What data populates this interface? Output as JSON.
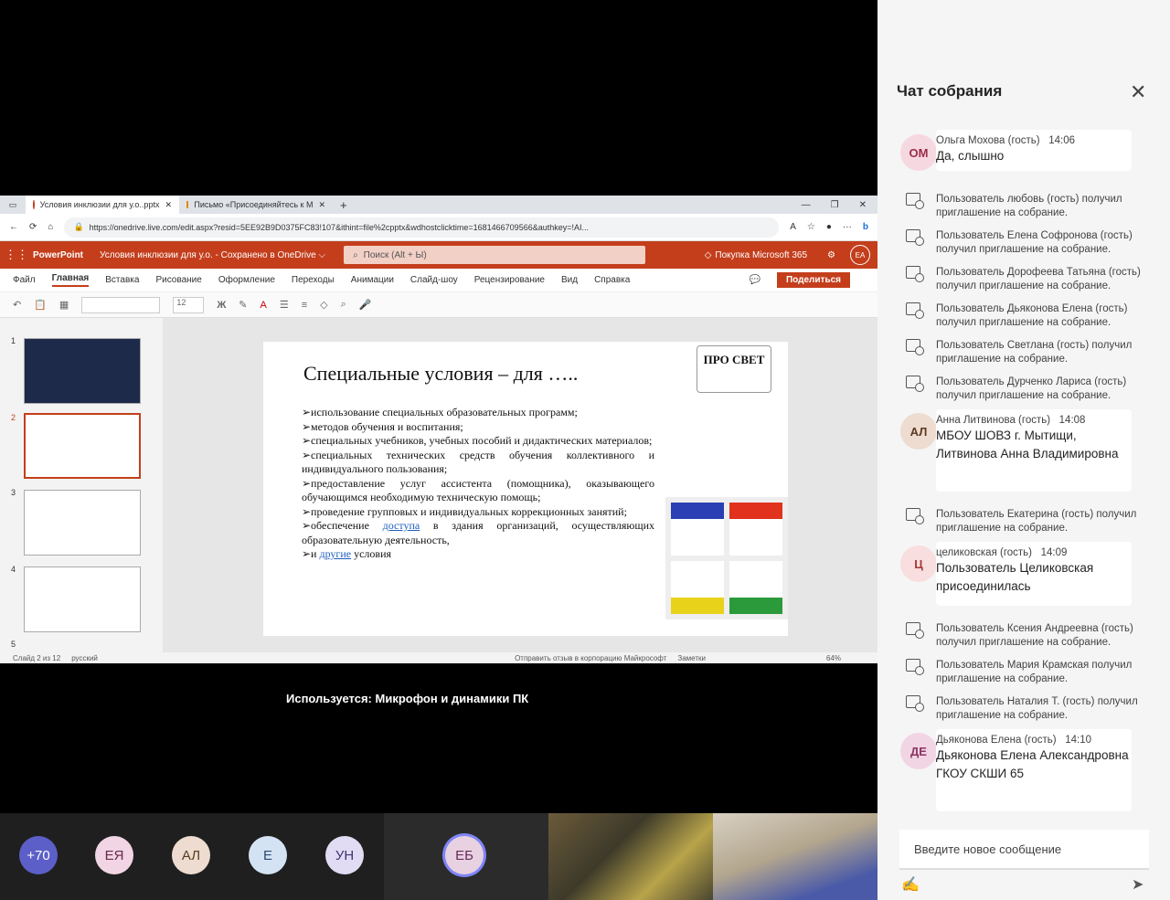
{
  "window_controls": {
    "minimize": "—",
    "restore": "❐",
    "close": "✕"
  },
  "shared": {
    "tabs": [
      {
        "label": "Условия инклюзии для у.о..pptx"
      },
      {
        "label": "Письмо «Присоединяйтесь к M"
      }
    ],
    "url": "https://onedrive.live.com/edit.aspx?resid=5EE92B9D0375FC83!107&ithint=file%2cpptx&wdhostclicktime=1681466709566&authkey=!AI...",
    "app_name": "PowerPoint",
    "doc_title": "Условия инклюзии для у.о. - Сохранено в OneDrive ⌵",
    "search_placeholder": "Поиск (Alt + Ы)",
    "buy": "Покупка Microsoft 365",
    "user_initials": "EA",
    "menu": [
      "Файл",
      "Главная",
      "Вставка",
      "Рисование",
      "Оформление",
      "Переходы",
      "Анимации",
      "Слайд-шоу",
      "Рецензирование",
      "Вид",
      "Справка"
    ],
    "share_button": "Поделиться",
    "font_size": "12",
    "slide": {
      "title": "Специальные условия – для …..",
      "logo": "ПРО СВЕТ",
      "bullets": [
        "➢использование специальных образовательных программ;",
        "➢методов обучения и воспитания;",
        "➢специальных учебников, учебных пособий и дидактических материалов;",
        "➢специальных технических средств обучения коллективного и индивидуального пользования;",
        "➢предоставление услуг ассистента (помощника), оказывающего обучающимся необходимую техническую помощь;",
        "➢проведение групповых и индивидуальных коррекционных занятий;"
      ],
      "b7_pre": "➢обеспечение ",
      "b7_link": "доступа",
      "b7_post": " в здания организаций, осуществляющих образовательную деятельность,",
      "b8_pre": "➢и ",
      "b8_link": "другие",
      "b8_post": " условия"
    },
    "thumb_numbers": [
      "1",
      "2",
      "3",
      "4",
      "5"
    ],
    "status_left": "Слайд 2 из 12",
    "status_lang": "русский",
    "status_feedback": "Отправить отзыв в корпорацию Майкрософт",
    "status_notes": "Заметки",
    "zoom": "64%"
  },
  "device_label": "Используется: Микрофон и динамики ПК",
  "participants": [
    {
      "initials": "+70",
      "bg": "#5b5fc7",
      "fg": "#ffffff"
    },
    {
      "initials": "ЕЯ",
      "bg": "#f2d5e4",
      "fg": "#6b2b4b"
    },
    {
      "initials": "АЛ",
      "bg": "#eddccf",
      "fg": "#5b3a22"
    },
    {
      "initials": "Е",
      "bg": "#d4e3f4",
      "fg": "#2b4b73"
    },
    {
      "initials": "УН",
      "bg": "#e1dcf3",
      "fg": "#3f3470"
    },
    {
      "initials": "ЕБ",
      "bg": "#e8d2e2",
      "fg": "#6a2a59"
    }
  ],
  "chat": {
    "title": "Чат собрания",
    "input_placeholder": "Введите новое сообщение",
    "items": [
      {
        "kind": "msg",
        "initials": "ОМ",
        "bg": "#f6d8e0",
        "fg": "#9b2d4a",
        "name": "Ольга Мохова (гость)",
        "time": "14:06",
        "text": "Да, слышно"
      },
      {
        "kind": "sys",
        "text": "Пользователь любовь (гость) получил приглашение на собрание."
      },
      {
        "kind": "sys",
        "text": "Пользователь Елена Софронова (гость) получил приглашение на собрание."
      },
      {
        "kind": "sys",
        "text": "Пользователь Дорофеева Татьяна (гость) получил приглашение на собрание."
      },
      {
        "kind": "sys",
        "text": "Пользователь Дьяконова Елена (гость) получил приглашение на собрание."
      },
      {
        "kind": "sys",
        "text": "Пользователь Светлана (гость) получил приглашение на собрание."
      },
      {
        "kind": "sys",
        "text": "Пользователь Дурченко Лариса (гость) получил приглашение на собрание."
      },
      {
        "kind": "msg",
        "initials": "АЛ",
        "bg": "#eddccf",
        "fg": "#5b3a22",
        "name": "Анна Литвинова (гость)",
        "time": "14:08",
        "text": "МБОУ ШОВЗ г. Мытищи, Литвинова Анна Владимировна"
      },
      {
        "kind": "sys",
        "text": "Пользователь Екатерина (гость) получил приглашение на собрание."
      },
      {
        "kind": "msg",
        "initials": "Ц",
        "bg": "#f8dede",
        "fg": "#a33a3a",
        "name": "целиковская (гость)",
        "time": "14:09",
        "text": "Пользователь Целиковская присоединилась"
      },
      {
        "kind": "sys",
        "text": "Пользователь Ксения Андреевна (гость) получил приглашение на собрание."
      },
      {
        "kind": "sys",
        "text": "Пользователь Мария Крамская получил приглашение на собрание."
      },
      {
        "kind": "sys",
        "text": "Пользователь Наталия Т. (гость) получил приглашение на собрание."
      },
      {
        "kind": "msg",
        "initials": "ДЕ",
        "bg": "#f2d5e4",
        "fg": "#8a3463",
        "name": "Дьяконова Елена (гость)",
        "time": "14:10",
        "text": "Дьяконова Елена Александровна ГКОУ СКШИ 65"
      }
    ]
  }
}
